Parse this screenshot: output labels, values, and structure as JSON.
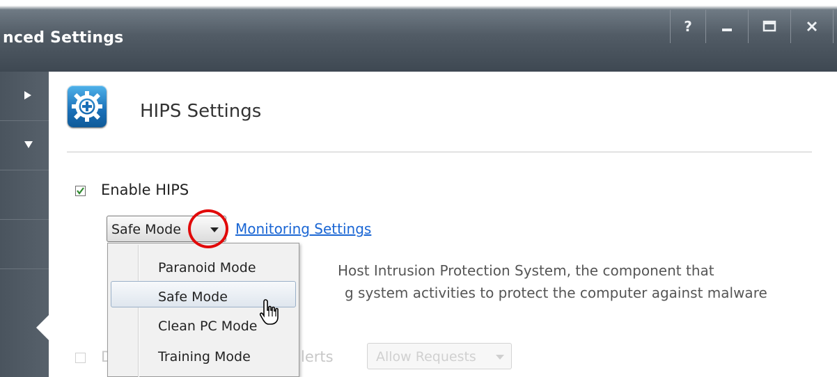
{
  "window": {
    "title": "nced Settings",
    "help_glyph": "?",
    "controls": [
      "help-icon",
      "minimize-icon",
      "maximize-icon",
      "close-icon"
    ]
  },
  "sidebar": {
    "items": [
      {
        "icon": "expand-arrow-right-icon"
      },
      {
        "icon": "collapse-arrow-down-icon"
      }
    ]
  },
  "page": {
    "icon": "hips-shield-gear-icon",
    "title": "HIPS Settings"
  },
  "enable_hips": {
    "checked": true,
    "label": "Enable HIPS"
  },
  "mode_select": {
    "selected": "Safe Mode",
    "options": [
      "Paranoid Mode",
      "Safe Mode",
      "Clean PC Mode",
      "Training Mode"
    ],
    "highlighted": "Safe Mode"
  },
  "monitoring_link": "Monitoring Settings",
  "description": {
    "line1": "Host Intrusion Protection System, the component that",
    "line2": "g system activities to protect the computer against malware"
  },
  "bottom_row": {
    "label_start": "D",
    "label_end": "lerts",
    "select_value": "Allow Requests"
  },
  "colors": {
    "titlebar": "#525c66",
    "link": "#1a66d4",
    "annotation_circle": "#e10a0a",
    "checkmark": "#2f8a2f"
  }
}
